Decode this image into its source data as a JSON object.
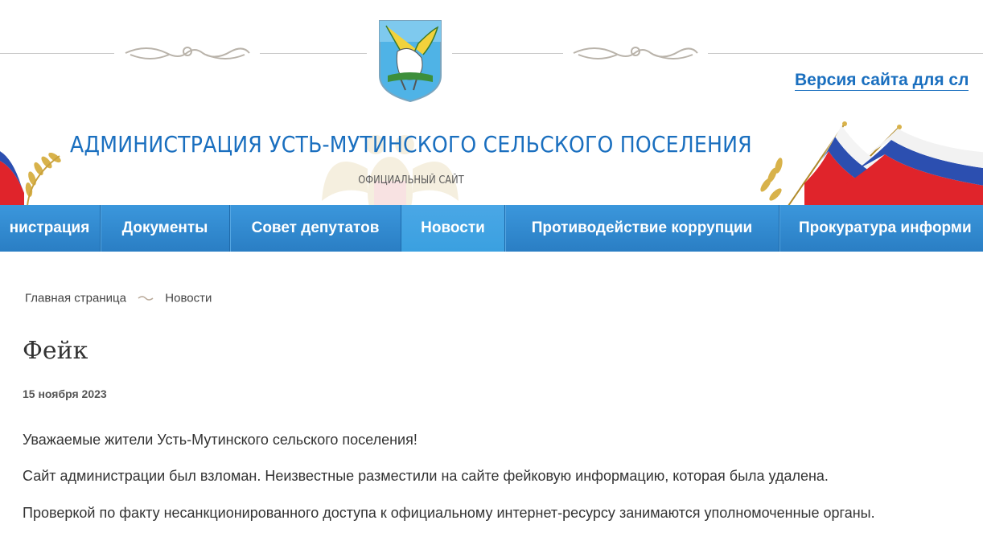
{
  "header": {
    "title": "АДМИНИСТРАЦИЯ УСТЬ-МУТИНСКОГО СЕЛЬСКОГО ПОСЕЛЕНИЯ",
    "subtitle": "ОФИЦИАЛЬНЫЙ САЙТ",
    "version_link": "Версия сайта для сл",
    "emblem": "coat-of-arms-icon",
    "ornament": "ornament-flourish-icon"
  },
  "nav": {
    "items": [
      {
        "label": "нистрация"
      },
      {
        "label": "Документы"
      },
      {
        "label": "Совет депутатов"
      },
      {
        "label": "Новости",
        "active": true
      },
      {
        "label": "Противодействие коррупции"
      },
      {
        "label": "Прокуратура информи"
      }
    ]
  },
  "breadcrumb": {
    "home": "Главная страница",
    "current": "Новости"
  },
  "article": {
    "title": "Фейк",
    "date": "15 ноября 2023",
    "paragraphs": [
      "Уважаемые жители Усть-Мутинского сельского поселения!",
      "Сайт администрации был взломан. Неизвестные разместили на сайте фейковую информацию, которая была удалена.",
      "Проверкой по факту несанкционированного доступа к официальному интернет-ресурсу занимаются уполномоченные органы."
    ]
  },
  "colors": {
    "accent": "#1a6fbf",
    "nav_bg": "#2a7ec4",
    "nav_active": "#3aa0e0",
    "text": "#333333"
  }
}
